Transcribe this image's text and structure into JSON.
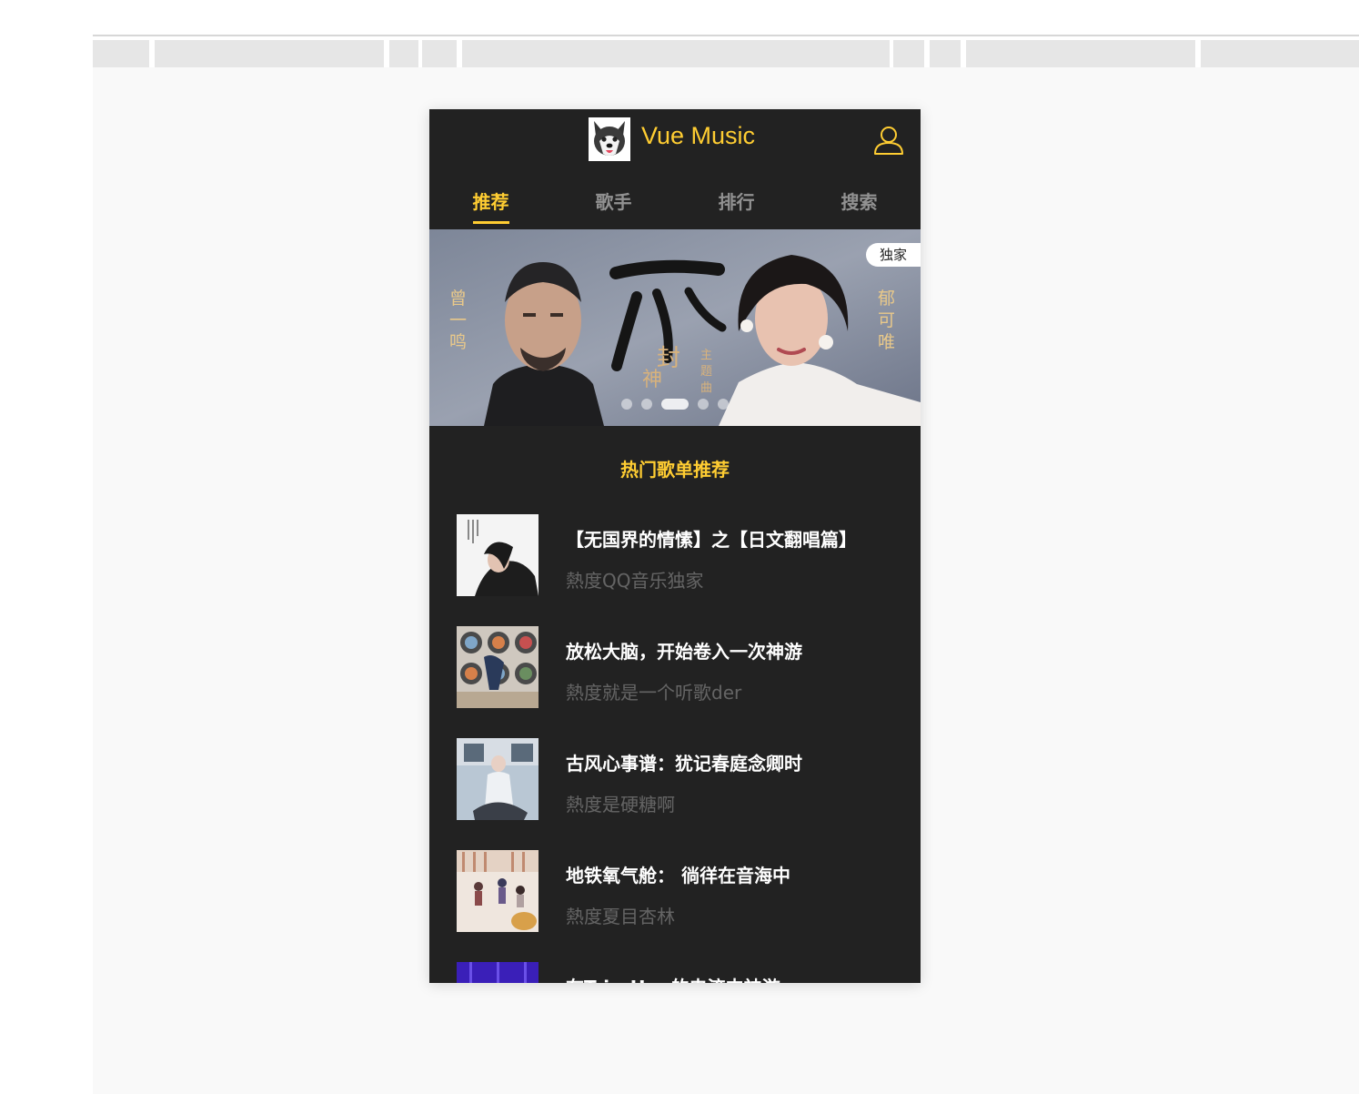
{
  "header": {
    "title": "Vue Music",
    "logo_icon": "husky-dog-logo-icon",
    "user_icon": "user-icon"
  },
  "tabs": [
    {
      "label": "推荐",
      "active": true
    },
    {
      "label": "歌手",
      "active": false
    },
    {
      "label": "排行",
      "active": false
    },
    {
      "label": "搜索",
      "active": false
    }
  ],
  "banner": {
    "badge": "独家",
    "left_artist": "曾一鸣",
    "right_artist": "郁可唯",
    "song_glyph": "一心",
    "subtitle_vertical": "主题曲",
    "movie_glyphs": "封神",
    "dots_count": 5,
    "active_dot": 2
  },
  "list": {
    "title": "热门歌单推荐",
    "items": [
      {
        "title": "【无国界的情愫】之【日文翻唱篇】",
        "desc": "熱度QQ音乐独家"
      },
      {
        "title": "放松大脑，开始卷入一次神游",
        "desc": "熱度就是一个听歌der"
      },
      {
        "title": "古风心事谱：犹记春庭念卿时",
        "desc": "熱度是硬糖啊"
      },
      {
        "title": "地铁氧气舱：  徜徉在音海中",
        "desc": "熱度夏目杏林"
      },
      {
        "title": "在Trip-Hop的电流中神游",
        "desc": ""
      }
    ]
  },
  "colors": {
    "accent": "#ffcd32",
    "background": "#222222"
  }
}
